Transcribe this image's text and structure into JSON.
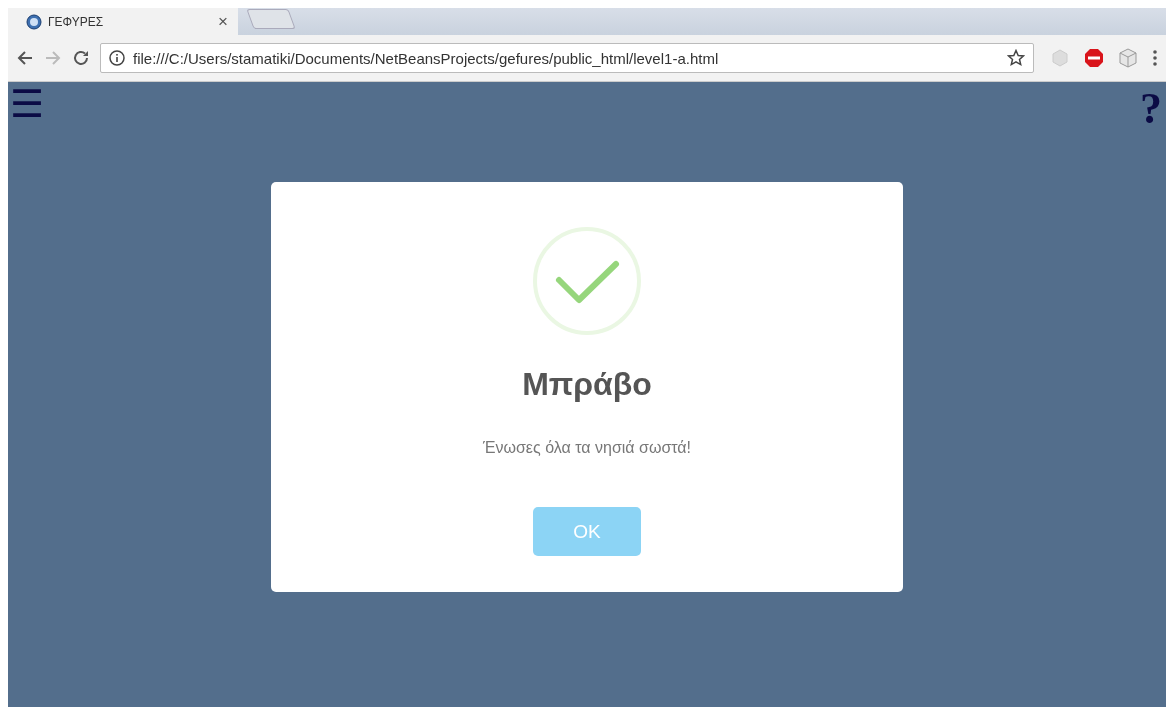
{
  "browser": {
    "tab": {
      "title": "ΓΕΦΥΡΕΣ",
      "close": "×",
      "selected": true
    },
    "address": "file:///C:/Users/stamatiki/Documents/NetBeansProjects/gefures/public_html/level1-a.html"
  },
  "page": {
    "menu_glyph": "☰",
    "help_glyph": "?"
  },
  "dialog": {
    "kind": "success",
    "title": "Μπράβο",
    "message": "Ένωσες όλα τα νησιά σωστά!",
    "buttons": [
      "OK"
    ]
  }
}
